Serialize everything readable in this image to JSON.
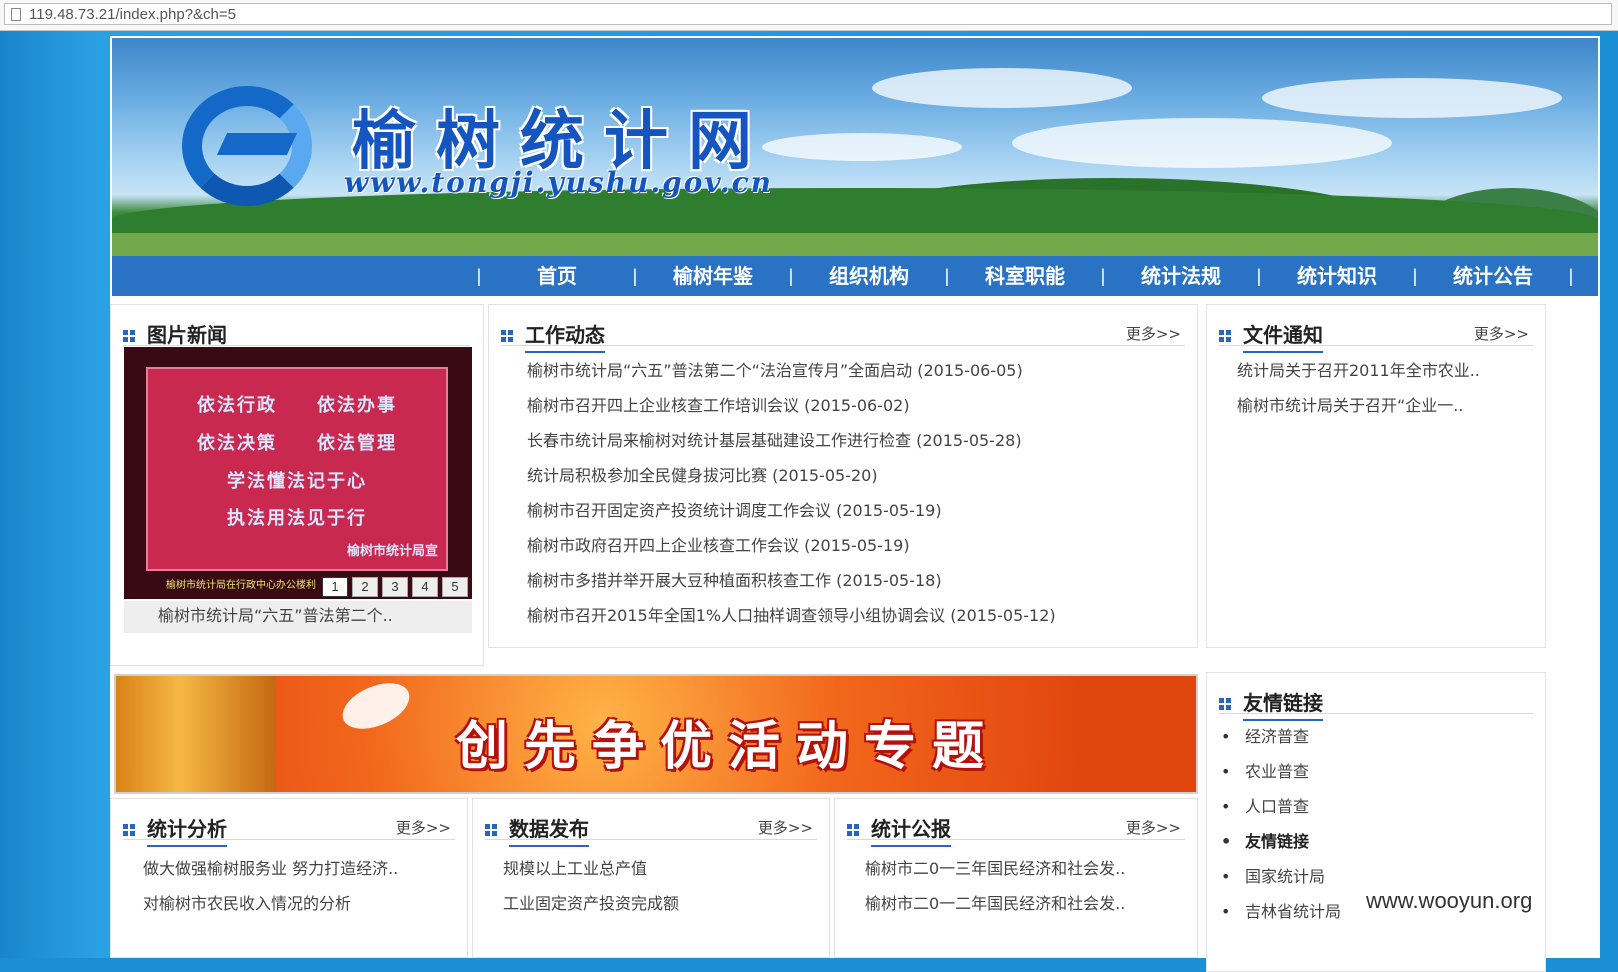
{
  "browser": {
    "url": "119.48.73.21/index.php?&ch=5"
  },
  "header": {
    "site_title": "榆树统计网",
    "site_url": "www.tongji.yushu.gov.cn"
  },
  "nav": {
    "items": [
      "首页",
      "榆树年鉴",
      "组织机构",
      "科室职能",
      "统计法规",
      "统计知识",
      "统计公告"
    ],
    "separator": "|"
  },
  "photo_news": {
    "title": "图片新闻",
    "screen_lines": [
      "依法行政　　依法办事",
      "依法决策　　依法管理",
      "学法懂法记于心",
      "执法用法见于行"
    ],
    "screen_sign": "榆树市统计局宣",
    "bottom_text": "榆树市统计局在行政中心办公楼利",
    "pager": [
      "1",
      "2",
      "3",
      "4",
      "5"
    ],
    "caption": "榆树市统计局“六五”普法第二个.."
  },
  "work_news": {
    "title": "工作动态",
    "more": "更多>>",
    "items": [
      "榆树市统计局“六五”普法第二个“法治宣传月”全面启动 (2015-06-05)",
      "榆树市召开四上企业核查工作培训会议 (2015-06-02)",
      "长春市统计局来榆树对统计基层基础建设工作进行检查 (2015-05-28)",
      "统计局积极参加全民健身拔河比赛 (2015-05-20)",
      "榆树市召开固定资产投资统计调度工作会议 (2015-05-19)",
      "榆树市政府召开四上企业核查工作会议 (2015-05-19)",
      "榆树市多措并举开展大豆种植面积核查工作 (2015-05-18)",
      "榆树市召开2015年全国1%人口抽样调查领导小组协调会议 (2015-05-12)"
    ]
  },
  "notices": {
    "title": "文件通知",
    "more": "更多>>",
    "items": [
      "统计局关于召开2011年全市农业..",
      "榆树市统计局关于召开“企业一.."
    ]
  },
  "promo": {
    "title": "创先争优活动专题"
  },
  "links": {
    "title": "友情链接",
    "items": [
      "经济普查",
      "农业普查",
      "人口普查",
      "友情链接",
      "国家统计局",
      "吉林省统计局"
    ]
  },
  "analysis": {
    "title": "统计分析",
    "more": "更多>>",
    "items": [
      "做大做强榆树服务业 努力打造经济..",
      "对榆树市农民收入情况的分析"
    ]
  },
  "data_release": {
    "title": "数据发布",
    "more": "更多>>",
    "items": [
      "规模以上工业总产值",
      "工业固定资产投资完成额"
    ]
  },
  "bulletin": {
    "title": "统计公报",
    "more": "更多>>",
    "items": [
      "榆树市二0一三年国民经济和社会发..",
      "榆树市二0一二年国民经济和社会发.."
    ]
  },
  "watermark": "www.wooyun.org",
  "colors": {
    "nav_bg": "#2a73c4",
    "accent": "#2566c4",
    "page_bg": "#1b8fd6"
  }
}
